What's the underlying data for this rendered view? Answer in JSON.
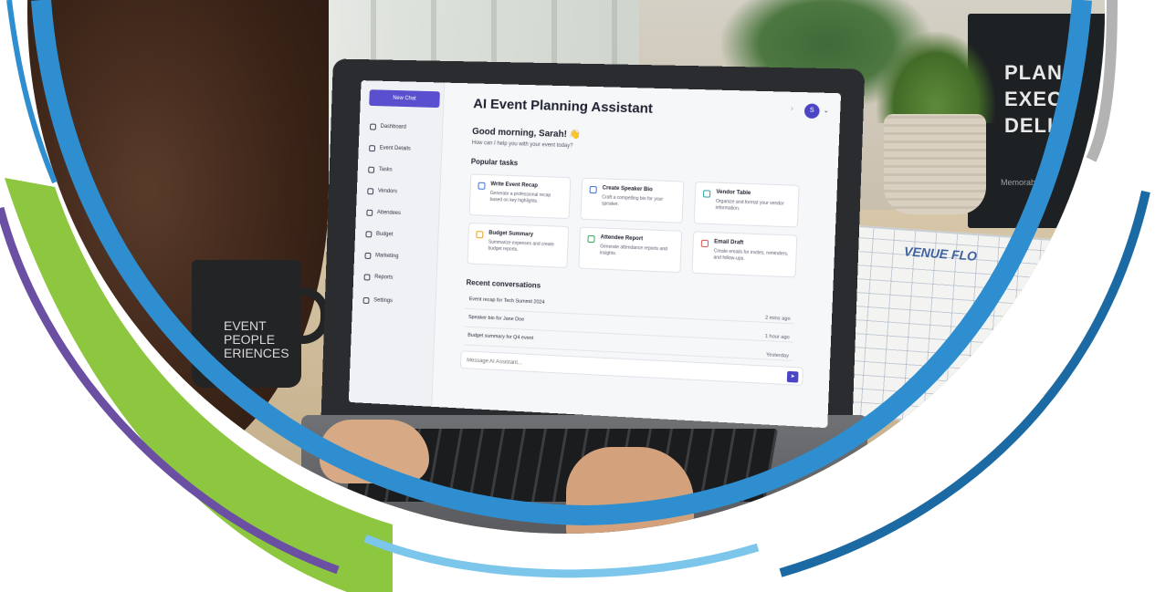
{
  "colors": {
    "primary_blue": "#2f8ed0",
    "dark_blue": "#1c6aa3",
    "light_blue": "#7cc6ec",
    "green": "#8dc63f",
    "purple": "#6b4fa3",
    "gray": "#b3b3b3",
    "app_accent": "#5a4fcf"
  },
  "background": {
    "book": {
      "title_lines": [
        "PLAN",
        "EXECU",
        "DELIV"
      ],
      "subtitle": "Memorabl"
    },
    "mug": {
      "text_lines": [
        "EVENT",
        "PEOPLE",
        "ERIENCES"
      ]
    },
    "floorplan": {
      "title": "VENUE FLO"
    }
  },
  "app": {
    "title": "AI Event Planning Assistant",
    "new_chat_label": "New Chat",
    "sidebar": {
      "items": [
        {
          "label": "Dashboard",
          "icon": "home-icon"
        },
        {
          "label": "Event Details",
          "icon": "document-icon"
        },
        {
          "label": "Tasks",
          "icon": "checklist-icon"
        },
        {
          "label": "Vendors",
          "icon": "vendors-icon"
        },
        {
          "label": "Attendees",
          "icon": "people-icon"
        },
        {
          "label": "Budget",
          "icon": "wallet-icon"
        },
        {
          "label": "Marketing",
          "icon": "megaphone-icon"
        },
        {
          "label": "Reports",
          "icon": "report-icon"
        },
        {
          "label": "Settings",
          "icon": "gear-icon"
        }
      ]
    },
    "user": {
      "avatar_initial": "S"
    },
    "greeting": "Good morning, Sarah! 👋",
    "subgreeting": "How can I help you with your event today?",
    "popular_tasks": {
      "heading": "Popular tasks",
      "cards": [
        {
          "title": "Write Event Recap",
          "desc": "Generate a professional recap based on key highlights.",
          "icon": "edit-icon",
          "color": "#3b6fd0"
        },
        {
          "title": "Create Speaker Bio",
          "desc": "Craft a compelling bio for your speaker.",
          "icon": "edit-icon",
          "color": "#3b6fd0"
        },
        {
          "title": "Vendor Table",
          "desc": "Organize and format your vendor information.",
          "icon": "table-icon",
          "color": "#2aa3a8"
        },
        {
          "title": "Budget Summary",
          "desc": "Summarize expenses and create budget reports.",
          "icon": "budget-icon",
          "color": "#e4a21c"
        },
        {
          "title": "Attendee Report",
          "desc": "Generate attendance reports and insights.",
          "icon": "report-icon",
          "color": "#3aa35a"
        },
        {
          "title": "Email Draft",
          "desc": "Create emails for invites, reminders, and follow-ups.",
          "icon": "mail-icon",
          "color": "#e0564c"
        }
      ]
    },
    "recent": {
      "heading": "Recent conversations",
      "rows": [
        {
          "title": "Event recap for Tech Summit 2024",
          "time": "2 mins ago"
        },
        {
          "title": "Speaker bio for Jane Doe",
          "time": "1 hour ago"
        },
        {
          "title": "Budget summary for Q4 event",
          "time": "Yesterday"
        }
      ]
    },
    "composer": {
      "placeholder": "Message AI Assistant..."
    }
  }
}
